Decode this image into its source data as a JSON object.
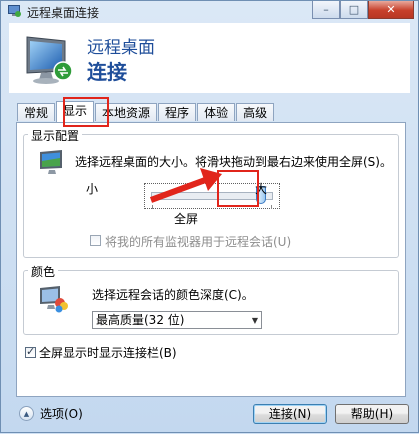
{
  "window": {
    "title": "远程桌面连接",
    "minimize": "–",
    "maximize": "□",
    "close": "✕"
  },
  "header": {
    "line1": "远程桌面",
    "line2": "连接"
  },
  "tabs": [
    {
      "label": "常规"
    },
    {
      "label": "显示"
    },
    {
      "label": "本地资源"
    },
    {
      "label": "程序"
    },
    {
      "label": "体验"
    },
    {
      "label": "高级"
    }
  ],
  "display_config": {
    "group_title": "显示配置",
    "description": "选择远程桌面的大小。将滑块拖动到最右边来使用全屏(S)。",
    "slider_min_label": "小",
    "slider_max_label": "大",
    "slider_value_label": "全屏",
    "slider_fraction": 1.0,
    "multi_monitor_label": "将我的所有监视器用于远程会话(U)",
    "multi_monitor_checked": false,
    "multi_monitor_enabled": false
  },
  "colors": {
    "group_title": "颜色",
    "description": "选择远程会话的颜色深度(C)。",
    "selected": "最高质量(32 位)"
  },
  "fullscreen_bar": {
    "label": "全屏显示时显示连接栏(B)",
    "checked": true
  },
  "footer": {
    "options_label": "选项(O)",
    "connect": "连接(N)",
    "help": "帮助(H)"
  },
  "accents": {
    "highlight": "#e1251b",
    "title_blue": "#1f4e9a"
  }
}
